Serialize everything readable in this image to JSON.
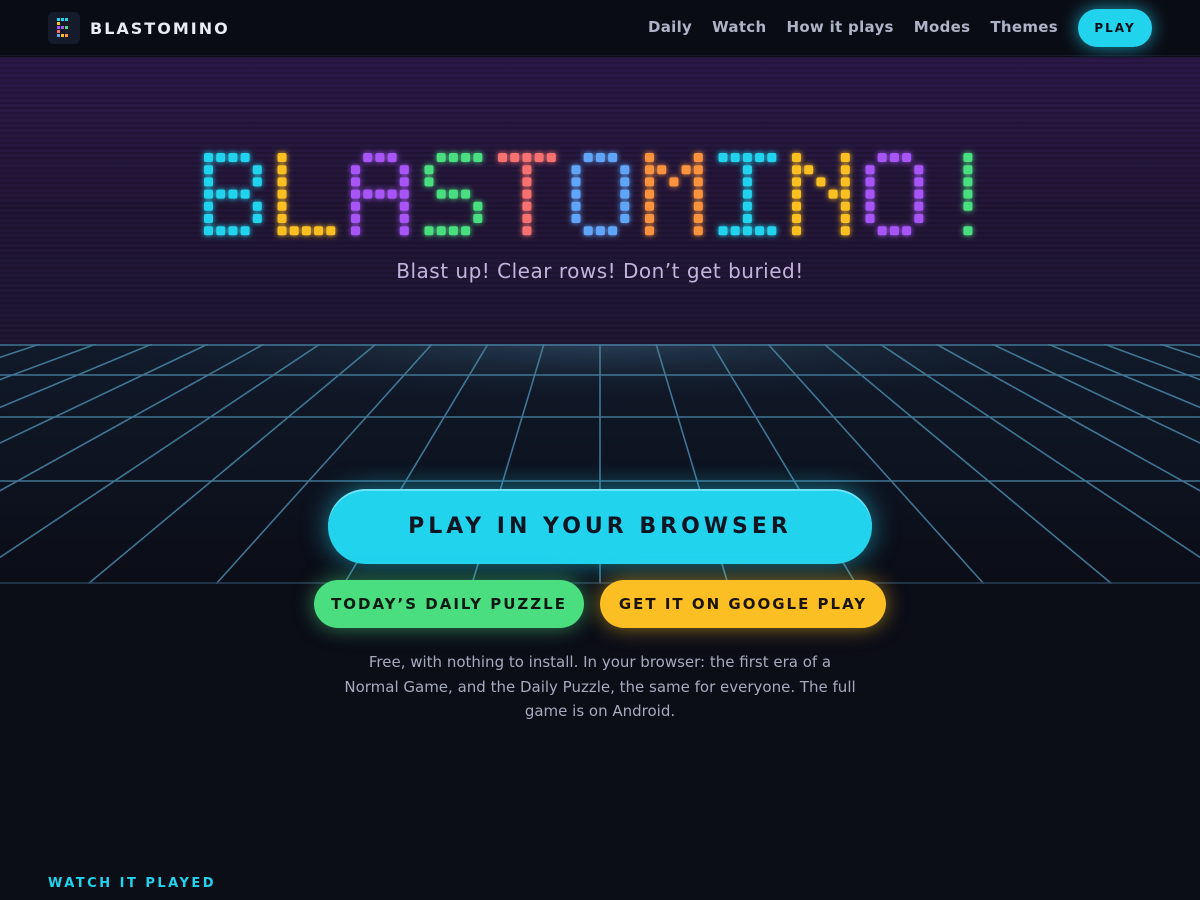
{
  "nav": {
    "brand": "BLASTOMINO",
    "links": [
      "Daily",
      "Watch",
      "How it plays",
      "Modes",
      "Themes"
    ],
    "play_label": "PLAY"
  },
  "hero": {
    "title": "BLASTOMINO!",
    "letter_colors": [
      "#22d3ee",
      "#fbbf24",
      "#a855f7",
      "#4ade80",
      "#f87171",
      "#60a5fa",
      "#fb923c",
      "#22d3ee",
      "#fbbf24",
      "#a855f7",
      "#4ade80"
    ],
    "tagline": "Blast up! Clear rows! Don’t get buried!"
  },
  "cta": {
    "main": "PLAY IN YOUR BROWSER",
    "daily": "TODAY’S DAILY PUZZLE",
    "google": "GET IT ON GOOGLE PLAY"
  },
  "note": "Free, with nothing to install. In your browser: the first era of a Normal Game, and the Daily Puzzle, the same for everyone. The full game is on Android.",
  "section_label": "WATCH IT PLAYED",
  "colors": {
    "accent_cyan": "#22d3ee",
    "green": "#4ade80",
    "yellow": "#fbbf24",
    "background": "#0b0d17",
    "hero_purple": "#2a1848"
  }
}
